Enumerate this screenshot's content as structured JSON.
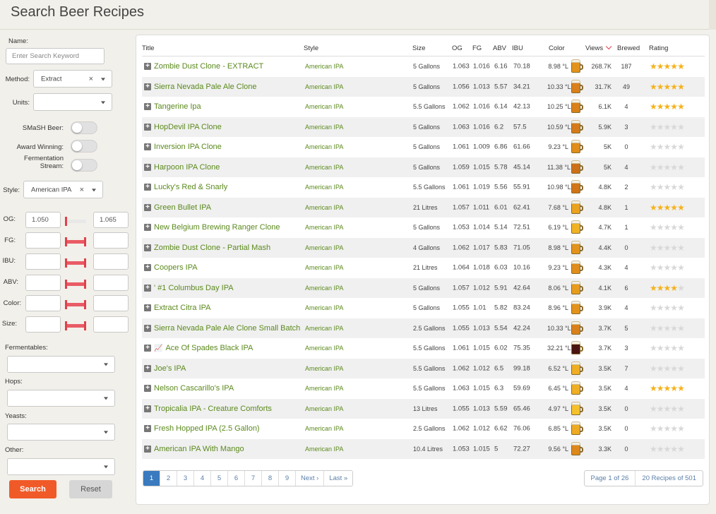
{
  "page_title": "Search Beer Recipes",
  "sidebar": {
    "name_label": "Name:",
    "name_placeholder": "Enter Search Keyword",
    "method_label": "Method:",
    "method_value": "Extract",
    "units_label": "Units:",
    "units_value": "",
    "smash_label": "SMaSH Beer:",
    "award_label": "Award Winning:",
    "fermentation_label": "Fermentation Stream:",
    "style_label": "Style:",
    "style_value": "American IPA",
    "og_label": "OG:",
    "og_min": "1.050",
    "og_max": "1.065",
    "fg_label": "FG:",
    "ibu_label": "IBU:",
    "abv_label": "ABV:",
    "color_label": "Color:",
    "size_label": "Size:",
    "fermentables_label": "Fermentables:",
    "hops_label": "Hops:",
    "yeasts_label": "Yeasts:",
    "other_label": "Other:",
    "search_button": "Search",
    "reset_button": "Reset"
  },
  "table": {
    "headers": {
      "title": "Title",
      "style": "Style",
      "size": "Size",
      "og": "OG",
      "fg": "FG",
      "abv": "ABV",
      "ibu": "IBU",
      "color": "Color",
      "views": "Views",
      "brewed": "Brewed",
      "rating": "Rating"
    },
    "rows": [
      {
        "title": "Zombie Dust Clone - EXTRACT",
        "style": "American IPA",
        "size": "5 Gallons",
        "og": "1.063",
        "fg": "1.016",
        "abv": "6.16",
        "ibu": "70.18",
        "color": "8.98 °L",
        "beer_color": "#e3931b",
        "views": "268.7K",
        "brewed": "187",
        "rating": 5
      },
      {
        "title": "Sierra Nevada Pale Ale Clone",
        "style": "American IPA",
        "size": "5 Gallons",
        "og": "1.056",
        "fg": "1.013",
        "abv": "5.57",
        "ibu": "34.21",
        "color": "10.33 °L",
        "beer_color": "#d9801a",
        "views": "31.7K",
        "brewed": "49",
        "rating": 5
      },
      {
        "title": "Tangerine Ipa",
        "style": "American IPA",
        "size": "5.5 Gallons",
        "og": "1.062",
        "fg": "1.016",
        "abv": "6.14",
        "ibu": "42.13",
        "color": "10.25 °L",
        "beer_color": "#d9801a",
        "views": "6.1K",
        "brewed": "4",
        "rating": 5
      },
      {
        "title": "HopDevil IPA Clone",
        "style": "American IPA",
        "size": "5 Gallons",
        "og": "1.063",
        "fg": "1.016",
        "abv": "6.2",
        "ibu": "57.5",
        "color": "10.59 °L",
        "beer_color": "#d47a19",
        "views": "5.9K",
        "brewed": "3",
        "rating": 0
      },
      {
        "title": "Inversion IPA Clone",
        "style": "American IPA",
        "size": "5 Gallons",
        "og": "1.061",
        "fg": "1.009",
        "abv": "6.86",
        "ibu": "61.66",
        "color": "9.23 °L",
        "beer_color": "#e08d1b",
        "views": "5K",
        "brewed": "0",
        "rating": 0
      },
      {
        "title": "Harpoon IPA Clone",
        "style": "American IPA",
        "size": "5 Gallons",
        "og": "1.059",
        "fg": "1.015",
        "abv": "5.78",
        "ibu": "45.14",
        "color": "11.38 °L",
        "beer_color": "#cc7018",
        "views": "5K",
        "brewed": "4",
        "rating": 0
      },
      {
        "title": "Lucky's Red & Snarly",
        "style": "American IPA",
        "size": "5.5 Gallons",
        "og": "1.061",
        "fg": "1.019",
        "abv": "5.56",
        "ibu": "55.91",
        "color": "10.98 °L",
        "beer_color": "#d07518",
        "views": "4.8K",
        "brewed": "2",
        "rating": 0
      },
      {
        "title": "Green Bullet IPA",
        "style": "American IPA",
        "size": "21 Litres",
        "og": "1.057",
        "fg": "1.011",
        "abv": "6.01",
        "ibu": "62.41",
        "color": "7.68 °L",
        "beer_color": "#eba21f",
        "views": "4.8K",
        "brewed": "1",
        "rating": 5
      },
      {
        "title": "New Belgium Brewing Ranger Clone",
        "style": "American IPA",
        "size": "5 Gallons",
        "og": "1.053",
        "fg": "1.014",
        "abv": "5.14",
        "ibu": "72.51",
        "color": "6.19 °L",
        "beer_color": "#f0b224",
        "views": "4.7K",
        "brewed": "1",
        "rating": 0
      },
      {
        "title": "Zombie Dust Clone - Partial Mash",
        "style": "American IPA",
        "size": "4 Gallons",
        "og": "1.062",
        "fg": "1.017",
        "abv": "5.83",
        "ibu": "71.05",
        "color": "8.98 °L",
        "beer_color": "#e3931b",
        "views": "4.4K",
        "brewed": "0",
        "rating": 0
      },
      {
        "title": "Coopers IPA",
        "style": "American IPA",
        "size": "21 Litres",
        "og": "1.064",
        "fg": "1.018",
        "abv": "6.03",
        "ibu": "10.16",
        "color": "9.23 °L",
        "beer_color": "#e08d1b",
        "views": "4.3K",
        "brewed": "4",
        "rating": 0
      },
      {
        "title": "' #1 Columbus Day IPA",
        "style": "American IPA",
        "size": "5 Gallons",
        "og": "1.057",
        "fg": "1.012",
        "abv": "5.91",
        "ibu": "42.64",
        "color": "8.06 °L",
        "beer_color": "#e89c1e",
        "views": "4.1K",
        "brewed": "6",
        "rating": 4
      },
      {
        "title": "Extract Citra IPA",
        "style": "American IPA",
        "size": "5 Gallons",
        "og": "1.055",
        "fg": "1.01",
        "abv": "5.82",
        "ibu": "83.24",
        "color": "8.96 °L",
        "beer_color": "#e3931b",
        "views": "3.9K",
        "brewed": "4",
        "rating": 0
      },
      {
        "title": "Sierra Nevada Pale Ale Clone Small Batch",
        "style": "American IPA",
        "size": "2.5 Gallons",
        "og": "1.055",
        "fg": "1.013",
        "abv": "5.54",
        "ibu": "42.24",
        "color": "10.33 °L",
        "beer_color": "#d9801a",
        "views": "3.7K",
        "brewed": "5",
        "rating": 0
      },
      {
        "title": "Ace Of Spades Black IPA",
        "style": "American IPA",
        "size": "5.5 Gallons",
        "og": "1.061",
        "fg": "1.015",
        "abv": "6.02",
        "ibu": "75.35",
        "color": "32.21 °L",
        "beer_color": "#4a1410",
        "views": "3.7K",
        "brewed": "3",
        "rating": 0,
        "chart": true
      },
      {
        "title": "Joe's IPA",
        "style": "American IPA",
        "size": "5.5 Gallons",
        "og": "1.062",
        "fg": "1.012",
        "abv": "6.5",
        "ibu": "99.18",
        "color": "6.52 °L",
        "beer_color": "#efae23",
        "views": "3.5K",
        "brewed": "7",
        "rating": 0
      },
      {
        "title": "Nelson Cascarillo's IPA",
        "style": "American IPA",
        "size": "5.5 Gallons",
        "og": "1.063",
        "fg": "1.015",
        "abv": "6.3",
        "ibu": "59.69",
        "color": "6.45 °L",
        "beer_color": "#efae23",
        "views": "3.5K",
        "brewed": "4",
        "rating": 5
      },
      {
        "title": "Tropicalia IPA - Creature Comforts",
        "style": "American IPA",
        "size": "13 Litres",
        "og": "1.055",
        "fg": "1.013",
        "abv": "5.59",
        "ibu": "65.46",
        "color": "4.97 °L",
        "beer_color": "#f5c12b",
        "views": "3.5K",
        "brewed": "0",
        "rating": 0
      },
      {
        "title": "Fresh Hopped IPA (2.5 Gallon)",
        "style": "American IPA",
        "size": "2.5 Gallons",
        "og": "1.062",
        "fg": "1.012",
        "abv": "6.62",
        "ibu": "76.06",
        "color": "6.85 °L",
        "beer_color": "#eeaa22",
        "views": "3.5K",
        "brewed": "0",
        "rating": 0
      },
      {
        "title": "American IPA With Mango",
        "style": "American IPA",
        "size": "10.4 Litres",
        "og": "1.053",
        "fg": "1.015",
        "abv": "5",
        "ibu": "72.27",
        "color": "9.56 °L",
        "beer_color": "#dd881a",
        "views": "3.3K",
        "brewed": "0",
        "rating": 0
      }
    ]
  },
  "pagination": {
    "pages": [
      "1",
      "2",
      "3",
      "4",
      "5",
      "6",
      "7",
      "8",
      "9"
    ],
    "active": "1",
    "next": "Next ›",
    "last": "Last »",
    "page_info": "Page 1 of 26",
    "recipe_info": "20 Recipes of 501"
  },
  "colors": {
    "accent": "#f05a28",
    "link": "#5b8a1d",
    "star": "#f5b21b",
    "range": "#e95b65",
    "page_active": "#3a7abf"
  }
}
